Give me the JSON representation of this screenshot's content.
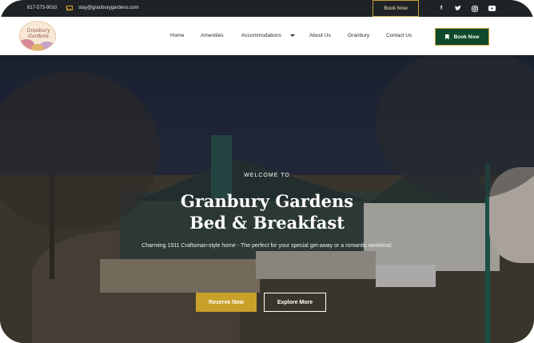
{
  "topbar": {
    "phone": "817-573-9010",
    "email": "stay@granburygardens.com",
    "book_label": "Book Now",
    "social_icons": [
      "facebook-icon",
      "twitter-icon",
      "instagram-icon",
      "youtube-icon"
    ]
  },
  "header": {
    "logo_text": "Granbury Gardens",
    "nav": [
      "Home",
      "Amenities",
      "Accommodations",
      "About Us",
      "Granbury",
      "Contact Us"
    ],
    "book_label": "Book Now"
  },
  "hero": {
    "welcome": "WELCOME TO",
    "title_line1": "Granbury Gardens",
    "title_line2": "Bed & Breakfast",
    "subtitle": "Charming 1911 Craftsman-style home - The perfect for your special get-away or a romantic weekend.",
    "reserve_label": "Reserve Now",
    "explore_label": "Explore More"
  },
  "colors": {
    "accent": "#c9a12a",
    "green": "#0f4a2b",
    "topbar": "#1f2326"
  }
}
